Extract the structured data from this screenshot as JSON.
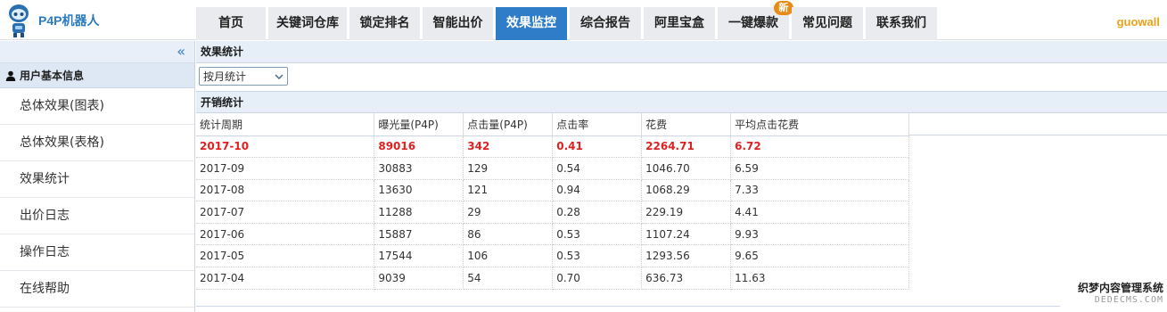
{
  "app": {
    "logo_text": "P4P机器人",
    "user": "guowall"
  },
  "nav": [
    {
      "label": "首页"
    },
    {
      "label": "关键词仓库"
    },
    {
      "label": "锁定排名"
    },
    {
      "label": "智能出价"
    },
    {
      "label": "效果监控",
      "active": true
    },
    {
      "label": "综合报告"
    },
    {
      "label": "阿里宝盒"
    },
    {
      "label": "一键爆款",
      "badge": "新"
    },
    {
      "label": "常见问题"
    },
    {
      "label": "联系我们"
    }
  ],
  "sidebar": {
    "collapse_glyph": "«",
    "section_title": "用户基本信息",
    "items": [
      {
        "label": "总体效果(图表)"
      },
      {
        "label": "总体效果(表格)"
      },
      {
        "label": "效果统计"
      },
      {
        "label": "出价日志"
      },
      {
        "label": "操作日志"
      },
      {
        "label": "在线帮助"
      }
    ]
  },
  "main": {
    "panel_title": "效果统计",
    "filter": {
      "selected": "按月统计"
    },
    "table_title": "开销统计",
    "columns": [
      "统计周期",
      "曝光量(P4P)",
      "点击量(P4P)",
      "点击率",
      "花费",
      "平均点击花费"
    ],
    "rows": [
      [
        "2017-10",
        "89016",
        "342",
        "0.41",
        "2264.71",
        "6.72"
      ],
      [
        "2017-09",
        "30883",
        "129",
        "0.54",
        "1046.70",
        "6.59"
      ],
      [
        "2017-08",
        "13630",
        "121",
        "0.94",
        "1068.29",
        "7.33"
      ],
      [
        "2017-07",
        "11288",
        "29",
        "0.28",
        "229.19",
        "4.41"
      ],
      [
        "2017-06",
        "15887",
        "86",
        "0.53",
        "1107.24",
        "9.93"
      ],
      [
        "2017-05",
        "17544",
        "106",
        "0.53",
        "1293.56",
        "9.65"
      ],
      [
        "2017-04",
        "9039",
        "54",
        "0.70",
        "636.73",
        "11.63"
      ]
    ],
    "highlight_row": 0
  },
  "watermark": {
    "line1": "织梦内容管理系统",
    "line2": "DEDECMS.COM"
  },
  "colors": {
    "accent": "#2f7dc8",
    "highlight": "#e02020",
    "user": "#e9a21a",
    "badge": "#e98c17"
  }
}
